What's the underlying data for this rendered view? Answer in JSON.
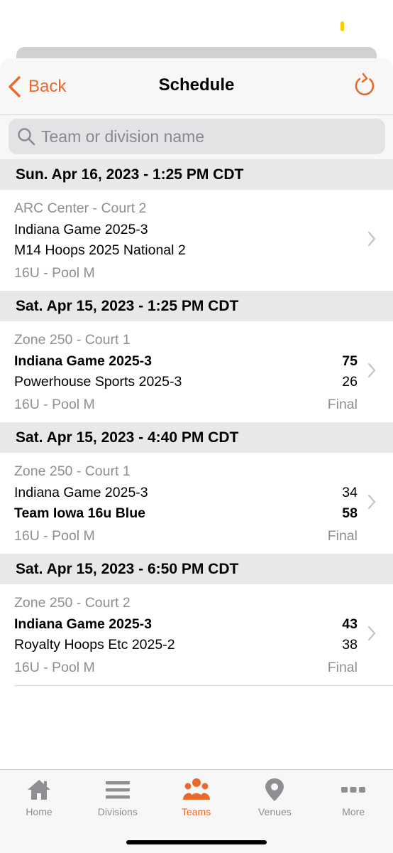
{
  "colors": {
    "accent": "#e8692a",
    "secondary_text": "#8e8e93",
    "section_bg": "#e8e8ea"
  },
  "nav": {
    "back_label": "Back",
    "title": "Schedule"
  },
  "search": {
    "placeholder": "Team or division name",
    "value": ""
  },
  "sections": [
    {
      "header": "Sun. Apr 16, 2023 - 1:25 PM CDT",
      "venue": "ARC Center - Court 2",
      "team1": "Indiana Game 2025-3",
      "team2": "M14 Hoops 2025 National 2",
      "score1": "",
      "score2": "",
      "pool": "16U - Pool M",
      "status": "",
      "winner": 0
    },
    {
      "header": "Sat. Apr 15, 2023 - 1:25 PM CDT",
      "venue": "Zone 250 - Court 1",
      "team1": "Indiana Game 2025-3",
      "team2": "Powerhouse Sports 2025-3",
      "score1": "75",
      "score2": "26",
      "pool": "16U - Pool M",
      "status": "Final",
      "winner": 1
    },
    {
      "header": "Sat. Apr 15, 2023 - 4:40 PM CDT",
      "venue": "Zone 250 - Court 1",
      "team1": "Indiana Game 2025-3",
      "team2": "Team Iowa 16u Blue",
      "score1": "34",
      "score2": "58",
      "pool": "16U - Pool M",
      "status": "Final",
      "winner": 2
    },
    {
      "header": "Sat. Apr 15, 2023 - 6:50 PM CDT",
      "venue": "Zone 250 - Court 2",
      "team1": "Indiana Game 2025-3",
      "team2": "Royalty Hoops Etc 2025-2",
      "score1": "43",
      "score2": "38",
      "pool": "16U - Pool M",
      "status": "Final",
      "winner": 1
    }
  ],
  "tabs": [
    {
      "label": "Home",
      "icon": "house-icon",
      "active": false
    },
    {
      "label": "Divisions",
      "icon": "list-icon",
      "active": false
    },
    {
      "label": "Teams",
      "icon": "people-icon",
      "active": true
    },
    {
      "label": "Venues",
      "icon": "map-pin-icon",
      "active": false
    },
    {
      "label": "More",
      "icon": "ellipsis-icon",
      "active": false
    }
  ]
}
